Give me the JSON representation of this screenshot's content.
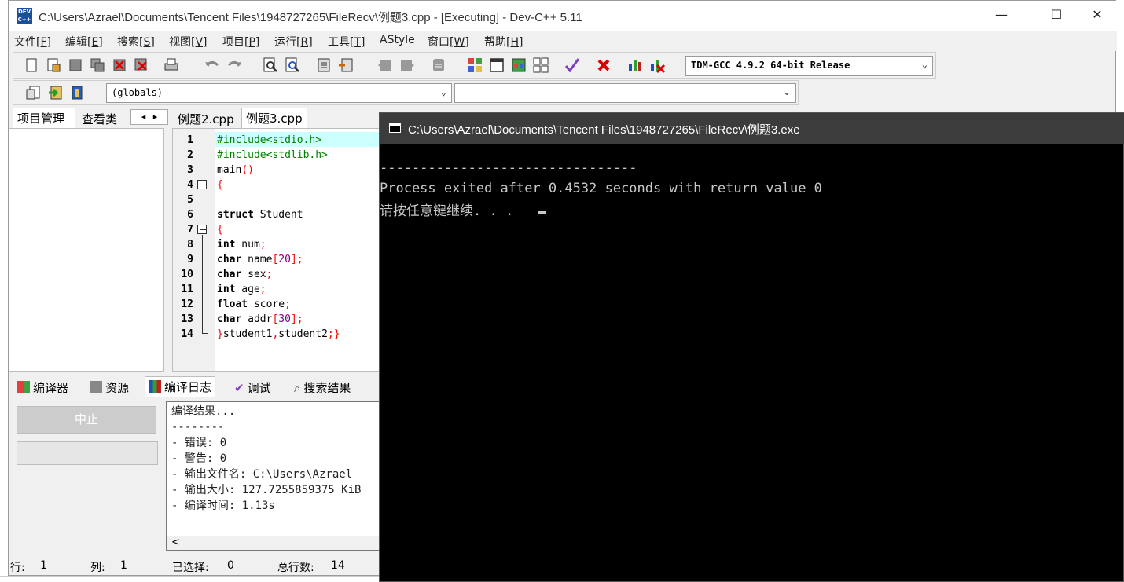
{
  "window": {
    "title": "C:\\Users\\Azrael\\Documents\\Tencent Files\\1948727265\\FileRecv\\例题3.cpp - [Executing] - Dev-C++ 5.11",
    "icon_text": "DEV C++",
    "controls": {
      "minimize": "—",
      "maximize": "☐",
      "close": "✕"
    }
  },
  "menubar": [
    {
      "label": "文件",
      "key": "[F]"
    },
    {
      "label": "编辑",
      "key": "[E]"
    },
    {
      "label": "搜索",
      "key": "[S]"
    },
    {
      "label": "视图",
      "key": "[V]"
    },
    {
      "label": "项目",
      "key": "[P]"
    },
    {
      "label": "运行",
      "key": "[R]"
    },
    {
      "label": "工具",
      "key": "[T]"
    },
    {
      "label": "AStyle",
      "key": ""
    },
    {
      "label": "窗口",
      "key": "[W]"
    },
    {
      "label": "帮助",
      "key": "[H]"
    }
  ],
  "toolbar": {
    "compiler": "TDM-GCC 4.9.2 64-bit Release",
    "scope": "(globals)",
    "function": ""
  },
  "left_panel": {
    "tabs": [
      "项目管理",
      "查看类"
    ],
    "nav": [
      "◂",
      "▸"
    ]
  },
  "editor": {
    "tabs": [
      "例题2.cpp",
      "例题3.cpp"
    ],
    "active_tab": "例题3.cpp",
    "line_numbers": [
      "1",
      "2",
      "3",
      "4",
      "5",
      "6",
      "7",
      "8",
      "9",
      "10",
      "11",
      "12",
      "13",
      "14"
    ],
    "lines": [
      "#include<stdio.h>",
      "#include<stdlib.h>",
      "main()",
      "{",
      "",
      "struct Student",
      "{",
      "int num;",
      "char name[20];",
      "char sex;",
      "int age;",
      "float score;",
      "char addr[30];",
      "}student1,student2;}"
    ]
  },
  "bottom_panel": {
    "tabs": [
      "编译器",
      "资源",
      "编译日志",
      "调试",
      "搜索结果"
    ],
    "active_tab": "编译日志",
    "abort_label": "中止",
    "log": [
      "编译结果...",
      "--------",
      "- 错误: 0",
      "- 警告: 0",
      "- 输出文件名: C:\\Users\\Azrael",
      "- 输出大小: 127.7255859375 KiB",
      "- 编译时间: 1.13s"
    ],
    "scroll_left": "<"
  },
  "statusbar": {
    "row_label": "行:",
    "row": "1",
    "col_label": "列:",
    "col": "1",
    "sel_label": "已选择:",
    "sel": "0",
    "total_label": "总行数:",
    "total": "14"
  },
  "console": {
    "title": "C:\\Users\\Azrael\\Documents\\Tencent Files\\1948727265\\FileRecv\\例题3.exe",
    "lines": [
      "--------------------------------",
      "Process exited after 0.4532 seconds with return value 0",
      "请按任意键继续. . . "
    ]
  },
  "colors": {
    "console_bg": "#000000",
    "console_text": "#c8c8c8",
    "console_titlebar": "#3c3c3c",
    "preprocessor": "#008000",
    "symbol": "#ff0000",
    "number": "#800080",
    "highlight_line": "#ccffff"
  }
}
